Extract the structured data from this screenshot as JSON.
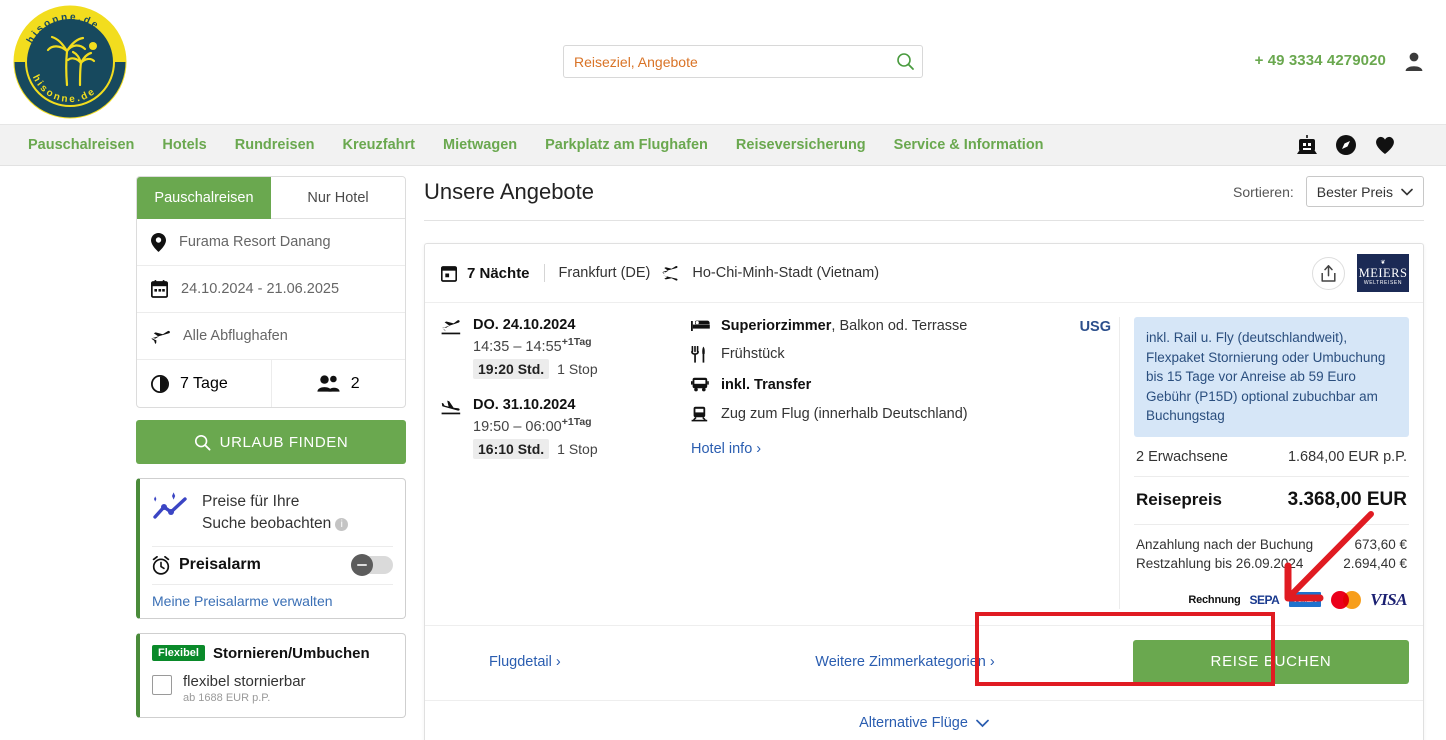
{
  "header": {
    "logo_top_text": "hisonne.de",
    "logo_bottom_text": "hisonne.de",
    "search_placeholder": "Reiseziel, Angebote",
    "search_value": "",
    "phone": "+ 49 3334 4279020"
  },
  "nav": {
    "items": [
      {
        "label": "Pauschalreisen"
      },
      {
        "label": "Hotels"
      },
      {
        "label": "Rundreisen"
      },
      {
        "label": "Kreuzfahrt"
      },
      {
        "label": "Mietwagen"
      },
      {
        "label": "Parkplatz am Flughafen"
      },
      {
        "label": "Reiseversicherung"
      },
      {
        "label": "Service & Information"
      }
    ],
    "icons": [
      "robot-icon",
      "compass-icon",
      "heart-icon"
    ]
  },
  "sidebar": {
    "tabs": [
      {
        "label": "Pauschalreisen",
        "active": true
      },
      {
        "label": "Nur Hotel",
        "active": false
      }
    ],
    "rows": [
      {
        "icon": "location-pin-icon",
        "value": "Furama Resort Danang"
      },
      {
        "icon": "calendar-icon",
        "value": "24.10.2024 - 21.06.2025"
      },
      {
        "icon": "plane-icon",
        "value": "Alle Abflughafen"
      }
    ],
    "duration": "7 Tage",
    "travellers": "2",
    "find_button": "URLAUB FINDEN",
    "price_watch": {
      "title_line1": "Preise für Ihre",
      "title_line2": "Suche beobachten",
      "alarm_label": "Preisalarm",
      "toggle_state": "off",
      "manage_link": "Meine Preisalarme verwalten"
    },
    "flex_card": {
      "badge": "Flexibel",
      "title": "Stornieren/Umbuchen",
      "option_label": "flexibel stornierbar",
      "option_sub": "ab 1688 EUR p.P.",
      "checked": false
    }
  },
  "main": {
    "page_title": "Unsere Angebote",
    "sort_label": "Sortieren:",
    "sort_value": "Bester Preis"
  },
  "offer": {
    "nights": "7 Nächte",
    "origin": "Frankfurt (DE)",
    "destination": "Ho-Chi-Minh-Stadt (Vietnam)",
    "brand_top": "❦",
    "brand_name": "MEIERS",
    "brand_sub": "WELTREISEN",
    "flights": [
      {
        "icon": "plane-departure-icon",
        "date": "DO. 24.10.2024",
        "time_from": "14:35",
        "time_to": "14:55",
        "day_offset": "+1Tag",
        "duration": "19:20 Std.",
        "stops": "1 Stop"
      },
      {
        "icon": "plane-arrival-icon",
        "date": "DO. 31.10.2024",
        "time_from": "19:50",
        "time_to": "06:00",
        "day_offset": "+1Tag",
        "duration": "16:10 Std.",
        "stops": "1 Stop"
      }
    ],
    "hotel": {
      "room_bold": "Superiorzimmer",
      "room_rest": ", Balkon od. Terrasse",
      "board": "Frühstück",
      "transfer": "inkl. Transfer",
      "train": "Zug zum Flug (innerhalb Deutschland)",
      "rating_code": "USG",
      "info_link": "Hotel info"
    },
    "info_box": "inkl. Rail u. Fly (deutschlandweit), Flexpaket Stornierung oder Umbuchung bis 15 Tage vor Anreise ab 59 Euro Gebühr (P15D) optional zubuchbar am Buchungstag",
    "pricing": {
      "pax_label": "2 Erwachsene",
      "pax_price": "1.684,00 EUR p.P.",
      "total_label": "Reisepreis",
      "total_price": "3.368,00 EUR",
      "deposit_label": "Anzahlung nach der Buchung",
      "deposit_value": "673,60 €",
      "balance_label": "Restzahlung bis 26.09.2024",
      "balance_value": "2.694,40 €"
    },
    "payments": [
      {
        "name": "Rechnung"
      },
      {
        "name": "SEPA"
      },
      {
        "name": "AMEX"
      },
      {
        "name": "Mastercard"
      },
      {
        "name": "VISA"
      }
    ],
    "actions": {
      "flight_detail": "Flugdetail",
      "more_rooms": "Weitere Zimmerkategorien",
      "book": "REISE BUCHEN",
      "alternative_flights": "Alternative Flüge"
    }
  },
  "colors": {
    "brand_green": "#6aa84f",
    "link_blue": "#2a5db0",
    "info_box_bg": "#d6e6f7",
    "highlight_red": "#e01b22",
    "logo_yellow": "#f2dd1e",
    "logo_navy": "#17495e"
  }
}
